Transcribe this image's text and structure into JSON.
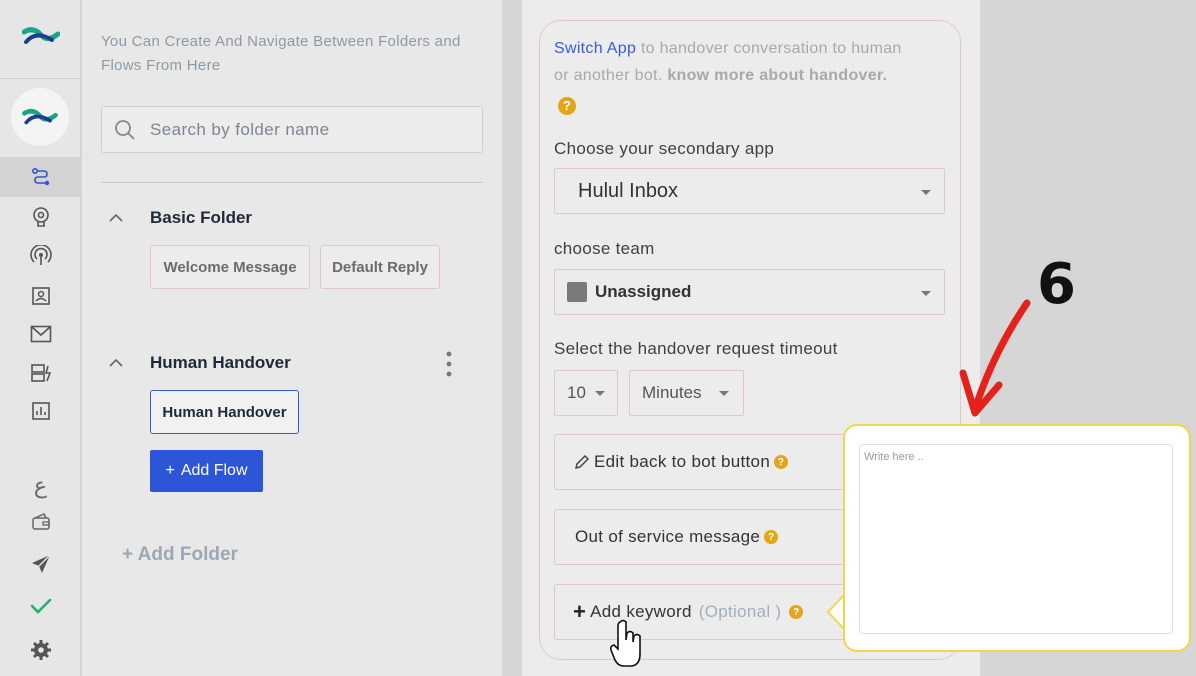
{
  "rail": {
    "logo": "hulul-logo",
    "items": [
      {
        "icon": "flow-icon",
        "active": true
      },
      {
        "icon": "brain-gear-icon"
      },
      {
        "icon": "broadcast-icon"
      },
      {
        "icon": "contacts-icon"
      },
      {
        "icon": "mail-icon"
      },
      {
        "icon": "integrations-icon"
      },
      {
        "icon": "analytics-icon"
      }
    ],
    "lang_label": "ع",
    "bottom": [
      {
        "icon": "wallet-icon"
      },
      {
        "icon": "send-icon"
      },
      {
        "icon": "check-icon"
      },
      {
        "icon": "settings-icon"
      }
    ]
  },
  "folders": {
    "intro": "You Can Create And Navigate Between Folders and Flows From Here",
    "search_placeholder": "Search by folder name",
    "list": [
      {
        "name": "Basic Folder",
        "flows": [
          "Welcome Message",
          "Default Reply"
        ]
      },
      {
        "name": "Human Handover",
        "flows": [
          "Human Handover"
        ]
      }
    ],
    "add_flow": "Add Flow",
    "add_folder": "+ Add Folder"
  },
  "handover": {
    "switch_link": "Switch App",
    "desc": " to handover conversation to human or another bot. ",
    "know_more": "know more about handover.",
    "secondary_app_label": "Choose your secondary app",
    "secondary_app_value": "Hulul Inbox",
    "team_label": "choose team",
    "team_value": "Unassigned",
    "timeout_label": "Select the handover request timeout",
    "timeout_value": "10",
    "timeout_unit": "Minutes",
    "edit_back_label": "Edit back to bot button",
    "out_of_service_label": "Out of service message",
    "add_keyword_label": "Add keyword",
    "add_keyword_optional": "(Optional )"
  },
  "annotation": {
    "step_number": "6",
    "arrow_color": "#e3221b"
  },
  "popup": {
    "placeholder": "Write here .."
  },
  "colors": {
    "accent": "#2d55d8",
    "help": "#e4a51a",
    "popup_border": "#f1d64a"
  }
}
